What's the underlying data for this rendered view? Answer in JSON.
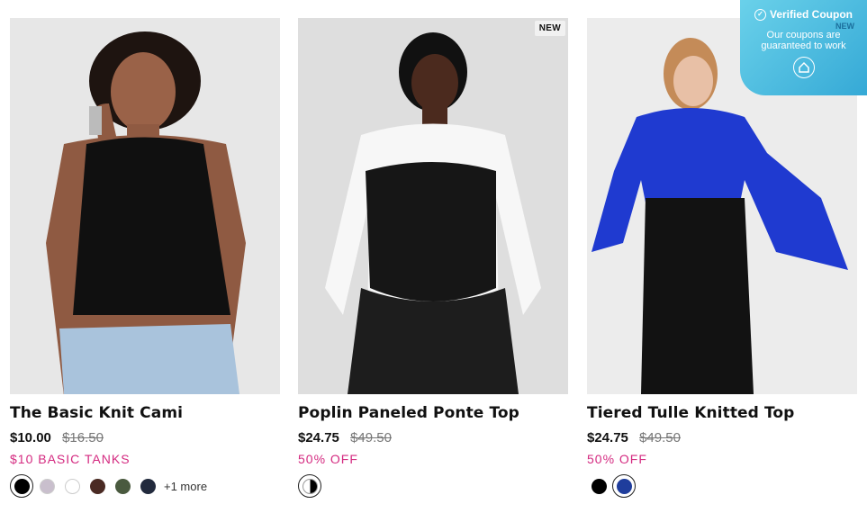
{
  "products": [
    {
      "name": "The Basic Knit Cami",
      "price": "$10.00",
      "was": "$16.50",
      "promo": "$10 BASIC TANKS",
      "new_badge": "",
      "more": "+1 more",
      "swatches": [
        "#000000",
        "#c9bfcd",
        "#ffffff",
        "#4a2a23",
        "#4a5a3f",
        "#222a3d"
      ]
    },
    {
      "name": "Poplin Paneled Ponte Top",
      "price": "$24.75",
      "was": "$49.50",
      "promo": "50% OFF",
      "new_badge": "NEW",
      "more": "",
      "swatches": [
        "half-black-white"
      ]
    },
    {
      "name": "Tiered Tulle Knitted Top",
      "price": "$24.75",
      "was": "$49.50",
      "promo": "50% OFF",
      "new_badge": "",
      "more": "",
      "swatches": [
        "#000000",
        "#1f3d9c"
      ]
    }
  ],
  "coupon": {
    "title": "Verified Coupon",
    "new_label": "NEW",
    "line1": "Our coupons are",
    "line2": "guaranteed to work"
  },
  "colors": {
    "promo": "#d42a80",
    "coupon_bg": "#4bbbe0"
  }
}
